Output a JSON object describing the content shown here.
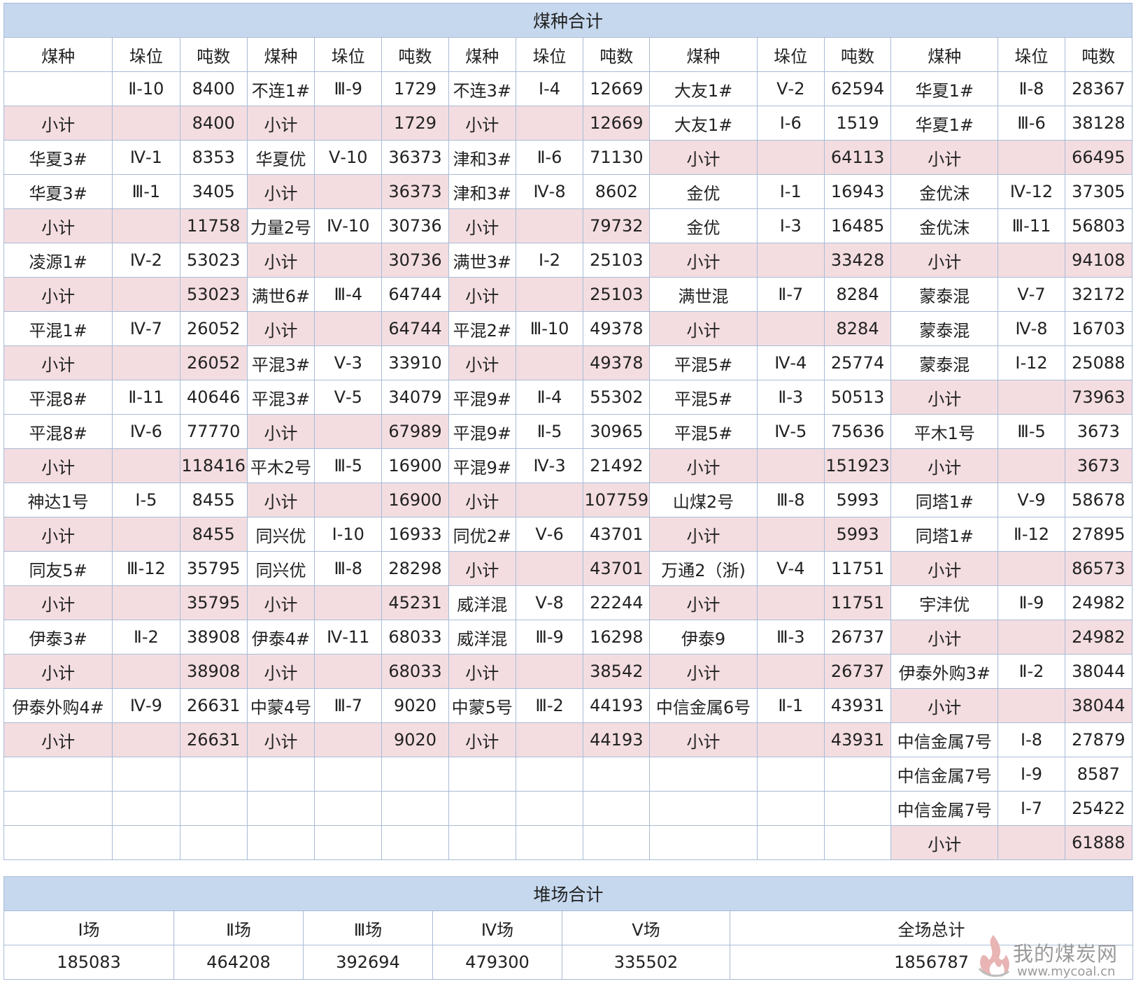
{
  "coal_section": {
    "title": "煤种合计",
    "headers": [
      "煤种",
      "垛位",
      "吨数",
      "煤种",
      "垛位",
      "吨数",
      "煤种",
      "垛位",
      "吨数",
      "煤种",
      "垛位",
      "吨数",
      "煤种",
      "垛位",
      "吨数"
    ],
    "rows": [
      {
        "g": [
          {
            "n": "",
            "p": "Ⅱ-10",
            "t": "8400",
            "s": false
          },
          {
            "n": "不连1#",
            "p": "Ⅲ-9",
            "t": "1729",
            "s": false
          },
          {
            "n": "不连3#",
            "p": "Ⅰ-4",
            "t": "12669",
            "s": false
          },
          {
            "n": "大友1#",
            "p": "Ⅴ-2",
            "t": "62594",
            "s": false
          },
          {
            "n": "华夏1#",
            "p": "Ⅱ-8",
            "t": "28367",
            "s": false
          }
        ]
      },
      {
        "g": [
          {
            "n": "小计",
            "p": "",
            "t": "8400",
            "s": true
          },
          {
            "n": "小计",
            "p": "",
            "t": "1729",
            "s": true
          },
          {
            "n": "小计",
            "p": "",
            "t": "12669",
            "s": true
          },
          {
            "n": "大友1#",
            "p": "Ⅰ-6",
            "t": "1519",
            "s": false
          },
          {
            "n": "华夏1#",
            "p": "Ⅲ-6",
            "t": "38128",
            "s": false
          }
        ]
      },
      {
        "g": [
          {
            "n": "华夏3#",
            "p": "Ⅳ-1",
            "t": "8353",
            "s": false
          },
          {
            "n": "华夏优",
            "p": "Ⅴ-10",
            "t": "36373",
            "s": false
          },
          {
            "n": "津和3#",
            "p": "Ⅱ-6",
            "t": "71130",
            "s": false
          },
          {
            "n": "小计",
            "p": "",
            "t": "64113",
            "s": true
          },
          {
            "n": "小计",
            "p": "",
            "t": "66495",
            "s": true
          }
        ]
      },
      {
        "g": [
          {
            "n": "华夏3#",
            "p": "Ⅲ-1",
            "t": "3405",
            "s": false
          },
          {
            "n": "小计",
            "p": "",
            "t": "36373",
            "s": true
          },
          {
            "n": "津和3#",
            "p": "Ⅳ-8",
            "t": "8602",
            "s": false
          },
          {
            "n": "金优",
            "p": "Ⅰ-1",
            "t": "16943",
            "s": false
          },
          {
            "n": "金优沫",
            "p": "Ⅳ-12",
            "t": "37305",
            "s": false
          }
        ]
      },
      {
        "g": [
          {
            "n": "小计",
            "p": "",
            "t": "11758",
            "s": true
          },
          {
            "n": "力量2号",
            "p": "Ⅳ-10",
            "t": "30736",
            "s": false
          },
          {
            "n": "小计",
            "p": "",
            "t": "79732",
            "s": true
          },
          {
            "n": "金优",
            "p": "Ⅰ-3",
            "t": "16485",
            "s": false
          },
          {
            "n": "金优沫",
            "p": "Ⅲ-11",
            "t": "56803",
            "s": false
          }
        ]
      },
      {
        "g": [
          {
            "n": "凌源1#",
            "p": "Ⅳ-2",
            "t": "53023",
            "s": false
          },
          {
            "n": "小计",
            "p": "",
            "t": "30736",
            "s": true
          },
          {
            "n": "满世3#",
            "p": "Ⅰ-2",
            "t": "25103",
            "s": false
          },
          {
            "n": "小计",
            "p": "",
            "t": "33428",
            "s": true
          },
          {
            "n": "小计",
            "p": "",
            "t": "94108",
            "s": true
          }
        ]
      },
      {
        "g": [
          {
            "n": "小计",
            "p": "",
            "t": "53023",
            "s": true
          },
          {
            "n": "满世6#",
            "p": "Ⅲ-4",
            "t": "64744",
            "s": false
          },
          {
            "n": "小计",
            "p": "",
            "t": "25103",
            "s": true
          },
          {
            "n": "满世混",
            "p": "Ⅱ-7",
            "t": "8284",
            "s": false
          },
          {
            "n": "蒙泰混",
            "p": "Ⅴ-7",
            "t": "32172",
            "s": false
          }
        ]
      },
      {
        "g": [
          {
            "n": "平混1#",
            "p": "Ⅳ-7",
            "t": "26052",
            "s": false
          },
          {
            "n": "小计",
            "p": "",
            "t": "64744",
            "s": true
          },
          {
            "n": "平混2#",
            "p": "Ⅲ-10",
            "t": "49378",
            "s": false
          },
          {
            "n": "小计",
            "p": "",
            "t": "8284",
            "s": true
          },
          {
            "n": "蒙泰混",
            "p": "Ⅳ-8",
            "t": "16703",
            "s": false
          }
        ]
      },
      {
        "g": [
          {
            "n": "小计",
            "p": "",
            "t": "26052",
            "s": true
          },
          {
            "n": "平混3#",
            "p": "Ⅴ-3",
            "t": "33910",
            "s": false
          },
          {
            "n": "小计",
            "p": "",
            "t": "49378",
            "s": true
          },
          {
            "n": "平混5#",
            "p": "Ⅳ-4",
            "t": "25774",
            "s": false
          },
          {
            "n": "蒙泰混",
            "p": "Ⅰ-12",
            "t": "25088",
            "s": false
          }
        ]
      },
      {
        "g": [
          {
            "n": "平混8#",
            "p": "Ⅱ-11",
            "t": "40646",
            "s": false
          },
          {
            "n": "平混3#",
            "p": "Ⅴ-5",
            "t": "34079",
            "s": false
          },
          {
            "n": "平混9#",
            "p": "Ⅱ-4",
            "t": "55302",
            "s": false
          },
          {
            "n": "平混5#",
            "p": "Ⅱ-3",
            "t": "50513",
            "s": false
          },
          {
            "n": "小计",
            "p": "",
            "t": "73963",
            "s": true
          }
        ]
      },
      {
        "g": [
          {
            "n": "平混8#",
            "p": "Ⅳ-6",
            "t": "77770",
            "s": false
          },
          {
            "n": "小计",
            "p": "",
            "t": "67989",
            "s": true
          },
          {
            "n": "平混9#",
            "p": "Ⅱ-5",
            "t": "30965",
            "s": false
          },
          {
            "n": "平混5#",
            "p": "Ⅳ-5",
            "t": "75636",
            "s": false
          },
          {
            "n": "平木1号",
            "p": "Ⅲ-5",
            "t": "3673",
            "s": false
          }
        ]
      },
      {
        "g": [
          {
            "n": "小计",
            "p": "",
            "t": "118416",
            "s": true
          },
          {
            "n": "平木2号",
            "p": "Ⅲ-5",
            "t": "16900",
            "s": false
          },
          {
            "n": "平混9#",
            "p": "Ⅳ-3",
            "t": "21492",
            "s": false
          },
          {
            "n": "小计",
            "p": "",
            "t": "151923",
            "s": true
          },
          {
            "n": "小计",
            "p": "",
            "t": "3673",
            "s": true
          }
        ]
      },
      {
        "g": [
          {
            "n": "神达1号",
            "p": "Ⅰ-5",
            "t": "8455",
            "s": false
          },
          {
            "n": "小计",
            "p": "",
            "t": "16900",
            "s": true
          },
          {
            "n": "小计",
            "p": "",
            "t": "107759",
            "s": true
          },
          {
            "n": "山煤2号",
            "p": "Ⅲ-8",
            "t": "5993",
            "s": false
          },
          {
            "n": "同塔1#",
            "p": "Ⅴ-9",
            "t": "58678",
            "s": false
          }
        ]
      },
      {
        "g": [
          {
            "n": "小计",
            "p": "",
            "t": "8455",
            "s": true
          },
          {
            "n": "同兴优",
            "p": "Ⅰ-10",
            "t": "16933",
            "s": false
          },
          {
            "n": "同优2#",
            "p": "Ⅴ-6",
            "t": "43701",
            "s": false
          },
          {
            "n": "小计",
            "p": "",
            "t": "5993",
            "s": true
          },
          {
            "n": "同塔1#",
            "p": "Ⅱ-12",
            "t": "27895",
            "s": false
          }
        ]
      },
      {
        "g": [
          {
            "n": "同友5#",
            "p": "Ⅲ-12",
            "t": "35795",
            "s": false
          },
          {
            "n": "同兴优",
            "p": "Ⅲ-8",
            "t": "28298",
            "s": false
          },
          {
            "n": "小计",
            "p": "",
            "t": "43701",
            "s": true
          },
          {
            "n": "万通2（浙)",
            "p": "Ⅴ-4",
            "t": "11751",
            "s": false
          },
          {
            "n": "小计",
            "p": "",
            "t": "86573",
            "s": true
          }
        ]
      },
      {
        "g": [
          {
            "n": "小计",
            "p": "",
            "t": "35795",
            "s": true
          },
          {
            "n": "小计",
            "p": "",
            "t": "45231",
            "s": true
          },
          {
            "n": "威洋混",
            "p": "Ⅴ-8",
            "t": "22244",
            "s": false
          },
          {
            "n": "小计",
            "p": "",
            "t": "11751",
            "s": true
          },
          {
            "n": "宇沣优",
            "p": "Ⅱ-9",
            "t": "24982",
            "s": false
          }
        ]
      },
      {
        "g": [
          {
            "n": "伊泰3#",
            "p": "Ⅱ-2",
            "t": "38908",
            "s": false
          },
          {
            "n": "伊泰4#",
            "p": "Ⅳ-11",
            "t": "68033",
            "s": false
          },
          {
            "n": "威洋混",
            "p": "Ⅲ-9",
            "t": "16298",
            "s": false
          },
          {
            "n": "伊泰9",
            "p": "Ⅲ-3",
            "t": "26737",
            "s": false
          },
          {
            "n": "小计",
            "p": "",
            "t": "24982",
            "s": true
          }
        ]
      },
      {
        "g": [
          {
            "n": "小计",
            "p": "",
            "t": "38908",
            "s": true
          },
          {
            "n": "小计",
            "p": "",
            "t": "68033",
            "s": true
          },
          {
            "n": "小计",
            "p": "",
            "t": "38542",
            "s": true
          },
          {
            "n": "小计",
            "p": "",
            "t": "26737",
            "s": true
          },
          {
            "n": "伊泰外购3#",
            "p": "Ⅱ-2",
            "t": "38044",
            "s": false
          }
        ]
      },
      {
        "g": [
          {
            "n": "伊泰外购4#",
            "p": "Ⅳ-9",
            "t": "26631",
            "s": false
          },
          {
            "n": "中蒙4号",
            "p": "Ⅲ-7",
            "t": "9020",
            "s": false
          },
          {
            "n": "中蒙5号",
            "p": "Ⅲ-2",
            "t": "44193",
            "s": false
          },
          {
            "n": "中信金属6号",
            "p": "Ⅱ-1",
            "t": "43931",
            "s": false
          },
          {
            "n": "小计",
            "p": "",
            "t": "38044",
            "s": true
          }
        ]
      },
      {
        "g": [
          {
            "n": "小计",
            "p": "",
            "t": "26631",
            "s": true
          },
          {
            "n": "小计",
            "p": "",
            "t": "9020",
            "s": true
          },
          {
            "n": "小计",
            "p": "",
            "t": "44193",
            "s": true
          },
          {
            "n": "小计",
            "p": "",
            "t": "43931",
            "s": true
          },
          {
            "n": "中信金属7号",
            "p": "Ⅰ-8",
            "t": "27879",
            "s": false
          }
        ]
      },
      {
        "g": [
          {
            "n": "",
            "p": "",
            "t": "",
            "s": false
          },
          {
            "n": "",
            "p": "",
            "t": "",
            "s": false
          },
          {
            "n": "",
            "p": "",
            "t": "",
            "s": false
          },
          {
            "n": "",
            "p": "",
            "t": "",
            "s": false
          },
          {
            "n": "中信金属7号",
            "p": "Ⅰ-9",
            "t": "8587",
            "s": false
          }
        ]
      },
      {
        "g": [
          {
            "n": "",
            "p": "",
            "t": "",
            "s": false
          },
          {
            "n": "",
            "p": "",
            "t": "",
            "s": false
          },
          {
            "n": "",
            "p": "",
            "t": "",
            "s": false
          },
          {
            "n": "",
            "p": "",
            "t": "",
            "s": false
          },
          {
            "n": "中信金属7号",
            "p": "Ⅰ-7",
            "t": "25422",
            "s": false
          }
        ]
      },
      {
        "g": [
          {
            "n": "",
            "p": "",
            "t": "",
            "s": false
          },
          {
            "n": "",
            "p": "",
            "t": "",
            "s": false
          },
          {
            "n": "",
            "p": "",
            "t": "",
            "s": false
          },
          {
            "n": "",
            "p": "",
            "t": "",
            "s": false
          },
          {
            "n": "小计",
            "p": "",
            "t": "61888",
            "s": true
          }
        ]
      }
    ]
  },
  "yard_section": {
    "title": "堆场合计",
    "headers": [
      "Ⅰ场",
      "Ⅱ场",
      "Ⅲ场",
      "Ⅳ场",
      "Ⅴ场",
      "全场总计"
    ],
    "values": [
      "185083",
      "464208",
      "392694",
      "479300",
      "335502",
      "1856787"
    ]
  },
  "watermark": {
    "name": "我的煤炭网",
    "url": "www.mycoal.cn",
    "logo_icon": "flame-logo-icon"
  },
  "colors": {
    "section_header_bg": "#c6d8ee",
    "subtotal_bg": "#f3dde1",
    "border": "#a9bcd6"
  }
}
